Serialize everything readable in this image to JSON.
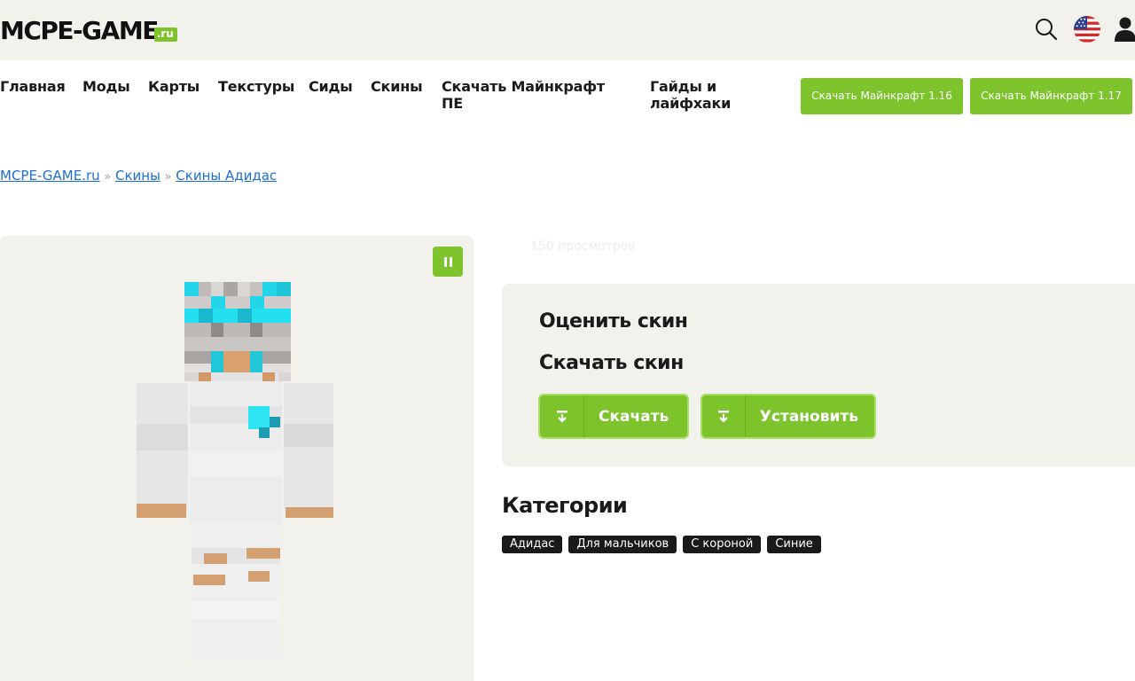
{
  "header": {
    "logo_text": "MCPE-GAME",
    "logo_suffix": ".ru",
    "icons": [
      "search-icon",
      "us-flag-icon",
      "user-icon"
    ]
  },
  "nav": {
    "items": [
      "Главная",
      "Моды",
      "Карты",
      "Текстуры",
      "Сиды",
      "Скины",
      "Скачать Майнкрафт ПЕ",
      "Гайды и лайфхаки"
    ],
    "buttons": [
      "Скачать Майнкрафт 1.16",
      "Скачать Майнкрафт 1.17"
    ]
  },
  "breadcrumb": {
    "items": [
      "MCPE-GAME.ru",
      "Скины",
      "Скины Адидас"
    ],
    "separator": "»"
  },
  "skin": {
    "views": "150 просмотров",
    "pause_icon": "pause-icon"
  },
  "actions": {
    "rate_title": "Оценить скин",
    "download_title": "Скачать скин",
    "download_label": "Скачать",
    "install_label": "Установить"
  },
  "categories": {
    "title": "Категории",
    "tags": [
      "Адидас",
      "Для мальчиков",
      "С короной",
      "Синие"
    ]
  },
  "colors": {
    "accent": "#7dc42c",
    "panel": "#f3f1ec",
    "link": "#1a6fd1",
    "tag_bg": "#1a1a1a"
  }
}
